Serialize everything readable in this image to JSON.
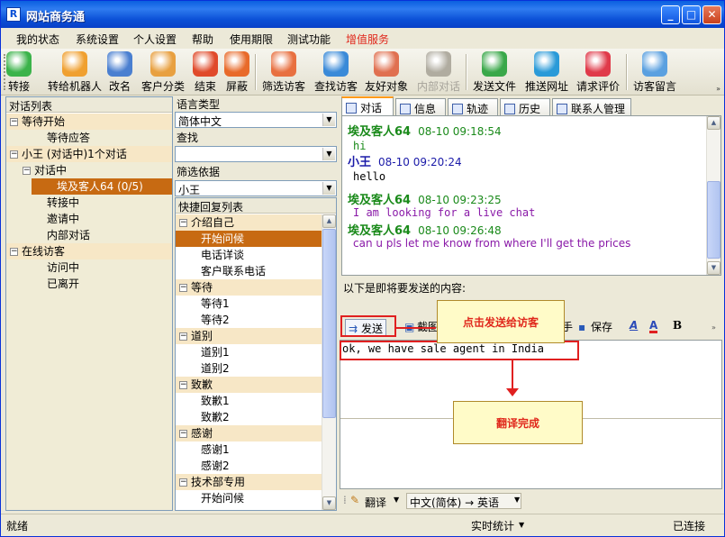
{
  "window": {
    "title": "网站商务通",
    "app_icon_letter": "R",
    "controls": {
      "min": "_",
      "max": "□",
      "close": "✕"
    }
  },
  "menu": [
    "我的状态",
    "系统设置",
    "个人设置",
    "帮助",
    "使用期限",
    "测试功能",
    "增值服务"
  ],
  "toolbar": [
    {
      "label": "转接",
      "icon": "transfer-icon",
      "color": "#3bb34a"
    },
    {
      "label": "转给机器人",
      "icon": "robot-icon",
      "color": "#f0a030"
    },
    {
      "label": "改名",
      "icon": "rename-card-icon",
      "color": "#4a7fd0"
    },
    {
      "label": "客户分类",
      "icon": "customer-group-icon",
      "color": "#e8a040"
    },
    {
      "label": "结束",
      "icon": "end-chat-icon",
      "color": "#e04a2a"
    },
    {
      "label": "屏蔽",
      "icon": "block-icon",
      "color": "#e86a2a"
    },
    {
      "label": "筛选访客",
      "icon": "filter-visitor-icon",
      "color": "#e87040"
    },
    {
      "label": "查找访客",
      "icon": "find-visitor-icon",
      "color": "#3a8ad8"
    },
    {
      "label": "友好对象",
      "icon": "friend-object-icon",
      "color": "#e07050"
    },
    {
      "label": "内部对话",
      "icon": "internal-chat-icon",
      "color": "#b0aca0",
      "disabled": true
    },
    {
      "label": "发送文件",
      "icon": "send-file-icon",
      "color": "#3aa84a"
    },
    {
      "label": "推送网址",
      "icon": "push-url-icon",
      "color": "#2a9ad8"
    },
    {
      "label": "请求评价",
      "icon": "request-rating-icon",
      "color": "#e03a4a"
    },
    {
      "label": "访客留言",
      "icon": "visitor-message-icon",
      "color": "#5aa0e0"
    }
  ],
  "left_panel": {
    "header": "对话列表",
    "tree": [
      {
        "label": "等待开始",
        "level": 0,
        "toggle": "−",
        "group": true
      },
      {
        "label": "等待应答",
        "level": 1
      },
      {
        "label": "小王 (对话中)1个对话",
        "level": 0,
        "toggle": "−",
        "group": true
      },
      {
        "label": "对话中",
        "level": 1,
        "toggle": "−"
      },
      {
        "label": "埃及客人64 (0/5)",
        "level": 2,
        "selected": true
      },
      {
        "label": "转接中",
        "level": 1
      },
      {
        "label": "邀请中",
        "level": 1
      },
      {
        "label": "内部对话",
        "level": 1
      },
      {
        "label": "在线访客",
        "level": 0,
        "toggle": "−",
        "group": true
      },
      {
        "label": "访问中",
        "level": 1
      },
      {
        "label": "已离开",
        "level": 1
      }
    ]
  },
  "middle_panel": {
    "language_label": "语言类型",
    "language_value": "简体中文",
    "search_label": "查找",
    "search_value": "",
    "filter_label": "筛选依据",
    "filter_value": "小王",
    "quick_reply_header": "快捷回复列表",
    "quick_replies": [
      {
        "label": "介绍自己",
        "group": true
      },
      {
        "label": "开始问候",
        "selected": true
      },
      {
        "label": "电话详谈"
      },
      {
        "label": "客户联系电话"
      },
      {
        "label": "等待",
        "group": true
      },
      {
        "label": "等待1"
      },
      {
        "label": "等待2"
      },
      {
        "label": "道别",
        "group": true
      },
      {
        "label": "道别1"
      },
      {
        "label": "道别2"
      },
      {
        "label": "致歉",
        "group": true
      },
      {
        "label": "致歉1"
      },
      {
        "label": "致歉2"
      },
      {
        "label": "感谢",
        "group": true
      },
      {
        "label": "感谢1"
      },
      {
        "label": "感谢2"
      },
      {
        "label": "技术部专用",
        "group": true
      },
      {
        "label": "开始问候"
      }
    ]
  },
  "tabs": [
    "对话",
    "信息",
    "轨迹",
    "历史",
    "联系人管理"
  ],
  "chat": [
    {
      "sender": "埃及客人64",
      "time": "08-10 09:18:54",
      "text": "hi",
      "sender_color": "#1a8a1a",
      "text_color": "#1a8a1a",
      "mono": true
    },
    {
      "sender": "小王",
      "time": "08-10 09:20:24",
      "text": "hello",
      "sender_color": "#1a1aa8",
      "text_color": "#000000",
      "mono": true
    },
    {
      "sender": "埃及客人64",
      "time": "08-10 09:23:25",
      "text": "I am looking for a live chat",
      "sender_color": "#1a8a1a",
      "text_color": "#8a1aa8",
      "mono": true
    },
    {
      "sender": "埃及客人64",
      "time": "08-10 09:26:48",
      "text": "can u pls let me know from where I'll get the prices",
      "sender_color": "#1a8a1a",
      "text_color": "#8a1aa8",
      "mono": false
    }
  ],
  "send_area": {
    "label": "以下是即将要发送的内容:",
    "send_button": "发送",
    "truncated_button": "截图",
    "truncated_button_2": "手",
    "save_button": "保存",
    "bold": "B",
    "font_color": "A",
    "draft": "ok, we have sale agent in India"
  },
  "translate_bar": {
    "label": "翻译",
    "direction": "中文(简体) → 英语"
  },
  "callouts": {
    "send": "点击发送给访客",
    "done": "翻译完成"
  },
  "status": {
    "left": "就绪",
    "mid": "实时统计",
    "right": "已连接"
  }
}
